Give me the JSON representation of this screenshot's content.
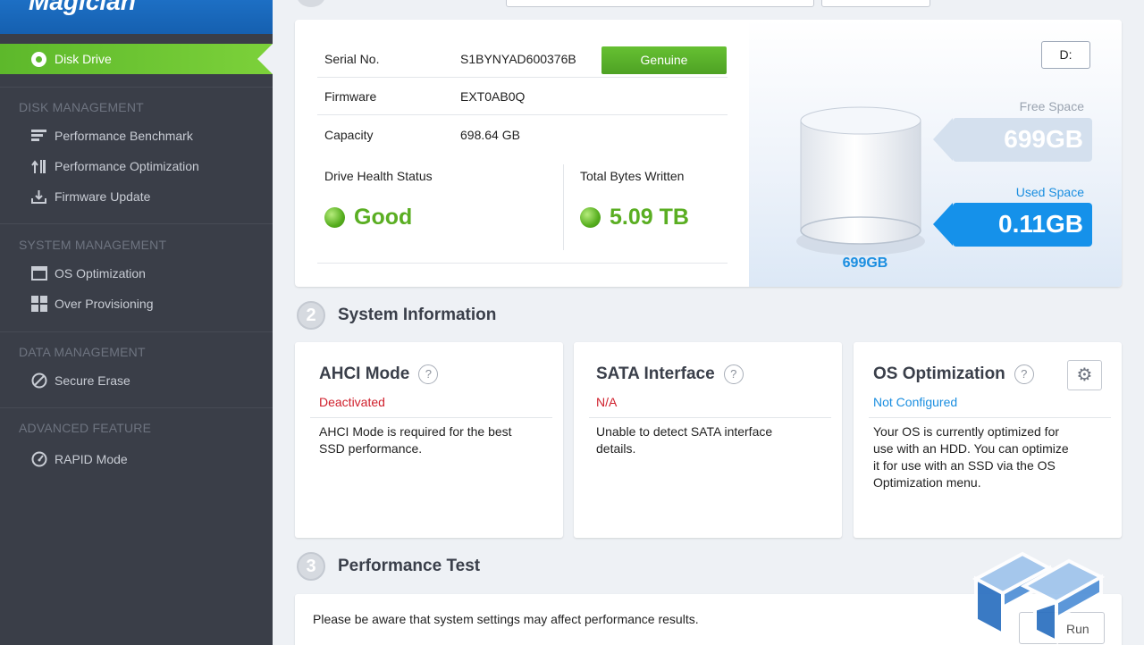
{
  "app": {
    "logo_text": "Magician"
  },
  "sidebar": {
    "active_item": {
      "label": "Disk Drive",
      "icon": "radio-dot-icon"
    },
    "sections": [
      {
        "title": "DISK MANAGEMENT",
        "items": [
          {
            "label": "Performance Benchmark",
            "icon": "benchmark-bars-icon"
          },
          {
            "label": "Performance Optimization",
            "icon": "optimization-arrows-icon"
          },
          {
            "label": "Firmware Update",
            "icon": "download-tray-icon"
          }
        ]
      },
      {
        "title": "SYSTEM MANAGEMENT",
        "items": [
          {
            "label": "OS Optimization",
            "icon": "window-icon"
          },
          {
            "label": "Over Provisioning",
            "icon": "grid-blocks-icon"
          }
        ]
      },
      {
        "title": "DATA MANAGEMENT",
        "items": [
          {
            "label": "Secure Erase",
            "icon": "prohibit-circle-icon"
          }
        ]
      },
      {
        "title": "ADVANCED FEATURE",
        "items": [
          {
            "label": "RAPID Mode",
            "icon": "speedometer-icon"
          }
        ]
      }
    ]
  },
  "drive": {
    "serial_label": "Serial No.",
    "serial_value": "S1BYNYAD600376B",
    "genuine_label": "Genuine",
    "firmware_label": "Firmware",
    "firmware_value": "EXT0AB0Q",
    "capacity_label": "Capacity",
    "capacity_value": "698.64 GB",
    "health_label": "Drive Health Status",
    "health_value": "Good",
    "tbw_label": "Total Bytes Written",
    "tbw_value": "5.09 TB",
    "drive_letter": "D:",
    "free_label": "Free Space",
    "free_value": "699GB",
    "used_label": "Used Space",
    "used_value": "0.11GB",
    "total_label": "699GB"
  },
  "system_info": {
    "number": "2",
    "title": "System Information",
    "cards": [
      {
        "title": "AHCI Mode",
        "status": "Deactivated",
        "status_color": "#d0202c",
        "desc": [
          "AHCI Mode is required for the best",
          "SSD performance."
        ]
      },
      {
        "title": "SATA Interface",
        "status": "N/A",
        "status_color": "#d0202c",
        "desc": [
          "Unable to detect SATA interface",
          "details."
        ]
      },
      {
        "title": "OS Optimization",
        "status": "Not Configured",
        "status_color": "#1a8ee0",
        "desc": [
          "Your OS is currently optimized for",
          "use with an HDD. You can optimize",
          "it for use with an SSD via the OS",
          "Optimization menu."
        ]
      }
    ]
  },
  "performance": {
    "number": "3",
    "title": "Performance Test",
    "note": "Please be aware that system settings may affect performance results.",
    "run_label": "Run"
  },
  "colors": {
    "accent_green": "#5aae22",
    "accent_blue": "#1a8ee0",
    "sidebar_bg": "#3a3e48",
    "error_red": "#d0202c"
  }
}
